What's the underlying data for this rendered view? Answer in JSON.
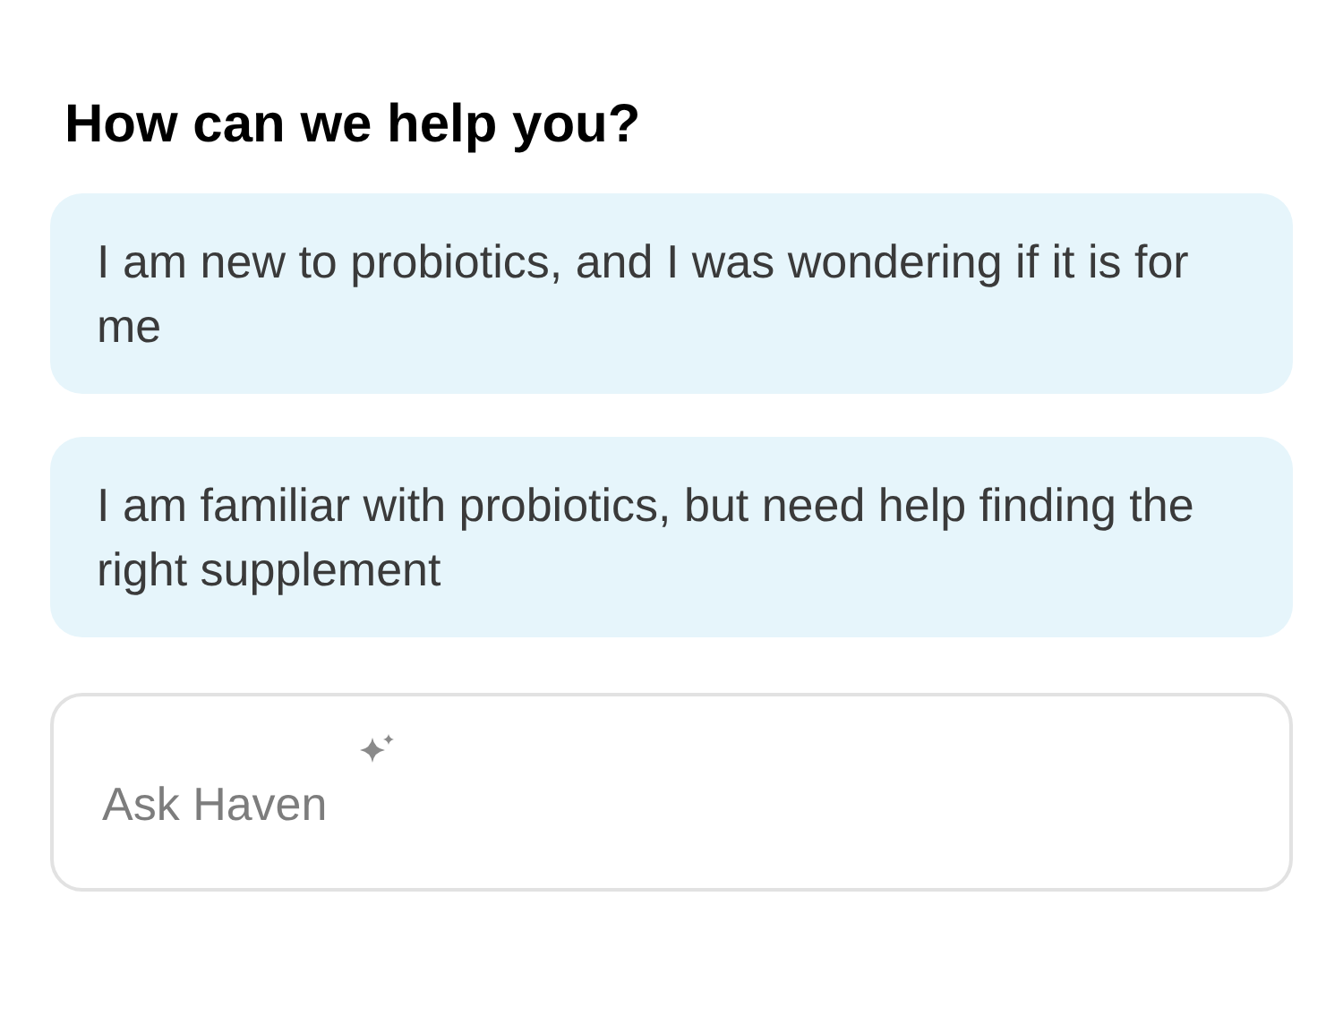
{
  "title": "How can we help you?",
  "suggestions": [
    {
      "text": "I am new to probiotics, and I was wondering if it is for me"
    },
    {
      "text": "I am familiar with probiotics, but need help finding the right supplement"
    }
  ],
  "ask_field": {
    "placeholder": "Ask Haven"
  }
}
